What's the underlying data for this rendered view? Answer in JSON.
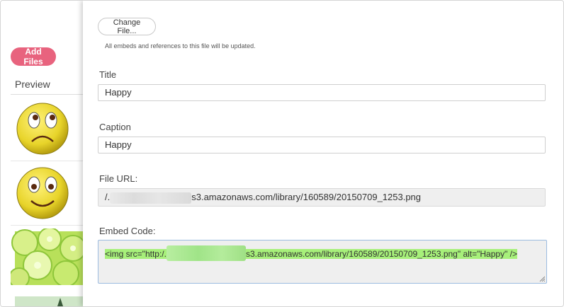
{
  "sidebar": {
    "add_files_label": "Add Files",
    "preview_label": "Preview",
    "thumbnails": [
      {
        "name": "sad-smiley-thumbnail"
      },
      {
        "name": "happy-smiley-thumbnail"
      },
      {
        "name": "lime-slices-thumbnail"
      },
      {
        "name": "partial-thumbnail"
      }
    ]
  },
  "modal": {
    "change_file_label": "Change File...",
    "change_file_note": "All embeds and references to this file will be updated.",
    "title_label": "Title",
    "title_value": "Happy",
    "caption_label": "Caption",
    "caption_value": "Happy",
    "file_url_label": "File URL:",
    "file_url_prefix": "/.",
    "file_url_suffix": "s3.amazonaws.com/library/160589/20150709_1253.png",
    "embed_label": "Embed Code:",
    "embed_prefix": "<img src=\"http:/.",
    "embed_suffix": "s3.amazonaws.com/library/160589/20150709_1253.png\" alt=\"Happy\" />"
  },
  "colors": {
    "accent_pink": "#e8637e",
    "selection_green": "#a7f07a",
    "smiley_yellow": "#e8d42a"
  }
}
